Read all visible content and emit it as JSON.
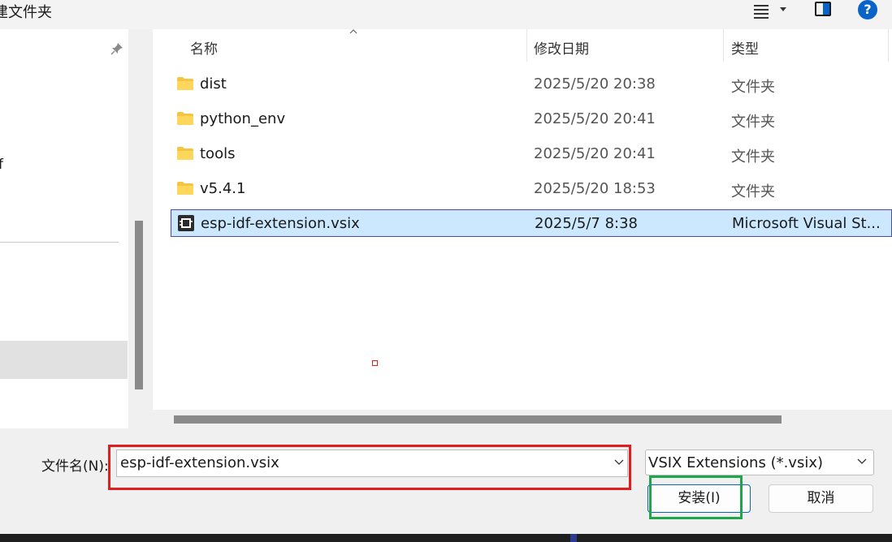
{
  "toolbar": {
    "new_folder_label": "建文件夹"
  },
  "nav": {
    "partial_item_label": "f"
  },
  "columns": {
    "name": "名称",
    "date_modified": "修改日期",
    "type": "类型"
  },
  "files": [
    {
      "name": "dist",
      "date": "2025/5/20 20:38",
      "type": "文件夹",
      "icon": "folder-icon"
    },
    {
      "name": "python_env",
      "date": "2025/5/20 20:41",
      "type": "文件夹",
      "icon": "folder-icon"
    },
    {
      "name": "tools",
      "date": "2025/5/20 20:41",
      "type": "文件夹",
      "icon": "folder-icon"
    },
    {
      "name": "v5.4.1",
      "date": "2025/5/20 18:53",
      "type": "文件夹",
      "icon": "folder-icon"
    },
    {
      "name": "esp-idf-extension.vsix",
      "date": "2025/5/7 8:38",
      "type": "Microsoft Visual St...",
      "icon": "vsix-file-icon",
      "selected": true
    }
  ],
  "bottom": {
    "filename_label": "文件名(N):",
    "filename_value": "esp-idf-extension.vsix",
    "filter_value": "VSIX Extensions (*.vsix)",
    "install_label": "安装(I)",
    "cancel_label": "取消"
  },
  "help_label": "?",
  "colors": {
    "selection_bg": "#cce8ff",
    "accent": "#0a63c9",
    "red_annotation": "#e01e1e",
    "green_annotation": "#1fa64a"
  }
}
